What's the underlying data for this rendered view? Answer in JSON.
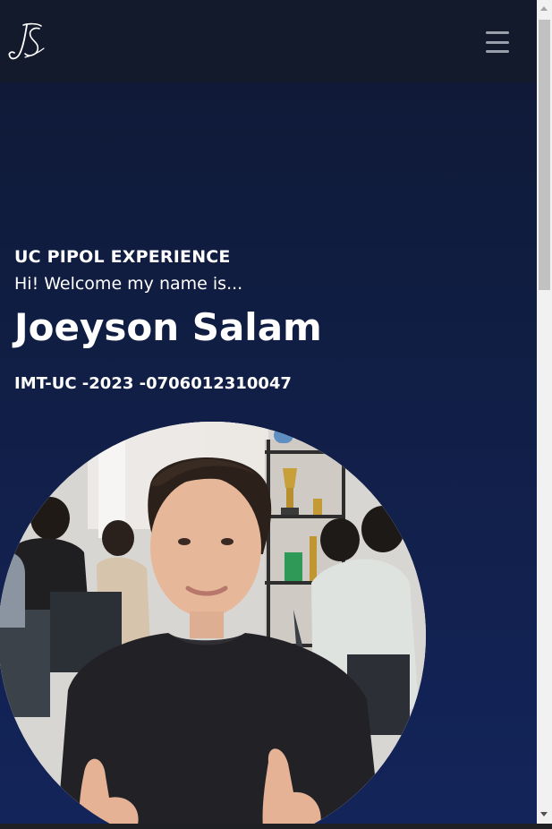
{
  "navbar": {
    "logo_icon": "js-monogram-logo",
    "menu_icon": "hamburger-menu-icon"
  },
  "hero": {
    "eyebrow": "UC PIPOL EXPERIENCE",
    "welcome": "Hi! Welcome my name is...",
    "name": "Joeyson Salam",
    "student_id": "IMT-UC -2023 -0706012310047"
  },
  "photo": {
    "subject": "profile-photo"
  },
  "colors": {
    "navbar": "#131a2b",
    "background_top": "#0f1934",
    "background_bottom": "#13245a",
    "text": "#ffffff"
  }
}
